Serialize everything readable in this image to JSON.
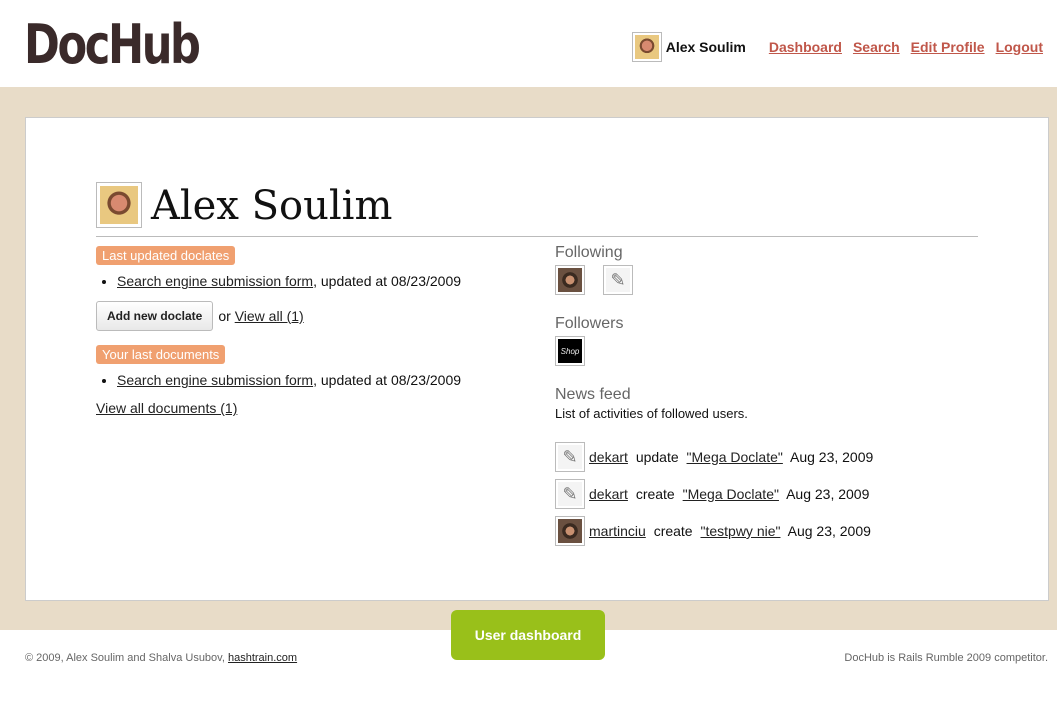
{
  "header": {
    "logo": "DocHub",
    "user_name": "Alex Soulim",
    "nav": [
      "Dashboard",
      "Search",
      "Edit Profile",
      "Logout"
    ]
  },
  "profile": {
    "name": "Alex Soulim"
  },
  "left": {
    "last_updated_tag": "Last updated doclates",
    "last_updated_items": [
      {
        "link": "Search engine submission form",
        "suffix": ", updated at 08/23/2009"
      }
    ],
    "add_button": "Add new doclate",
    "or_text": "or",
    "view_all": "View all (1)",
    "last_docs_tag": "Your last documents",
    "last_docs_items": [
      {
        "link": "Search engine submission form",
        "suffix": ", updated at 08/23/2009"
      }
    ],
    "view_all_docs": "View all documents (1)"
  },
  "right": {
    "following_heading": "Following",
    "following_icons": [
      "user-avatar-icon",
      "sketch-avatar-icon"
    ],
    "followers_heading": "Followers",
    "followers_icons": [
      "shop-avatar-icon"
    ],
    "news_heading": "News feed",
    "news_desc": "List of activities of followed users.",
    "feed": [
      {
        "user": "dekart",
        "action": "update",
        "doc": "\"Mega Doclate\"",
        "date": "Aug 23, 2009"
      },
      {
        "user": "dekart",
        "action": "create",
        "doc": "\"Mega Doclate\"",
        "date": "Aug 23, 2009"
      },
      {
        "user": "martinciu",
        "action": "create",
        "doc": "\"testpwy nie\"",
        "date": "Aug 23, 2009"
      }
    ]
  },
  "dashboard_button": "User dashboard",
  "footer": {
    "left_text": "© 2009, Alex Soulim and Shalva Usubov,",
    "left_link": "hashtrain.com",
    "right_text": "DocHub is Rails Rumble 2009 competitor."
  },
  "colors": {
    "band": "#e8dcc8",
    "nav_link": "#c0574a",
    "tag": "#f0a070",
    "dashboard_button": "#99c01a"
  }
}
